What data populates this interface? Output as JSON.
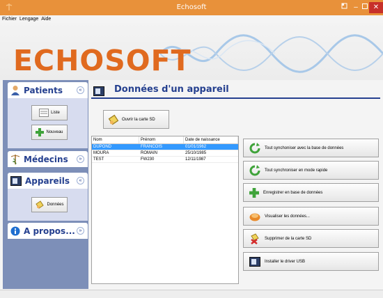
{
  "window": {
    "title": "Echosoft"
  },
  "menu": [
    "Fichier",
    "Lengage",
    "Aide"
  ],
  "banner": {
    "logo": "ECHOSOFT"
  },
  "colors": {
    "titlebar": "#e8913a",
    "accent": "#25408f",
    "sidebar": "#7d8fb8",
    "selection": "#3399ff",
    "close": "#c7302a"
  },
  "sidebar": {
    "patients": {
      "title": "Patients",
      "buttons": [
        {
          "label": "Liste",
          "icon": "list-icon"
        },
        {
          "label": "Nouveau",
          "icon": "plus-icon"
        }
      ]
    },
    "medecins": {
      "title": "Médecins"
    },
    "appareils": {
      "title": "Appareils",
      "buttons": [
        {
          "label": "Données",
          "icon": "sd-card-icon"
        }
      ]
    },
    "apropos": {
      "title": "A propos..."
    }
  },
  "main": {
    "title": "Données d'un appareil",
    "open_sd_label": "Ouvrir la carte SD",
    "table": {
      "headers": [
        "Nom",
        "Prénom",
        "Date de naissance"
      ],
      "rows": [
        [
          "DUPOND",
          "FRANCOIS",
          "01/01/1962"
        ],
        [
          "MOURA",
          "ROMAIN",
          "25/10/1985"
        ],
        [
          "TEST",
          "FW230",
          "12/11/1987"
        ]
      ]
    },
    "actions": [
      {
        "label": "Tout synchoniser avec la base de données",
        "icon": "sync-icon"
      },
      {
        "label": "Tout synchroniser en mode rapide",
        "icon": "sync-icon"
      },
      {
        "label": "Enregistrer en base de données",
        "icon": "plus-icon"
      },
      {
        "label": "Visualiser les données...",
        "icon": "view-icon"
      },
      {
        "label": "Supprimer de la carte SD",
        "icon": "delete-icon"
      },
      {
        "label": "Installer le driver USB",
        "icon": "usb-driver-icon"
      }
    ]
  }
}
